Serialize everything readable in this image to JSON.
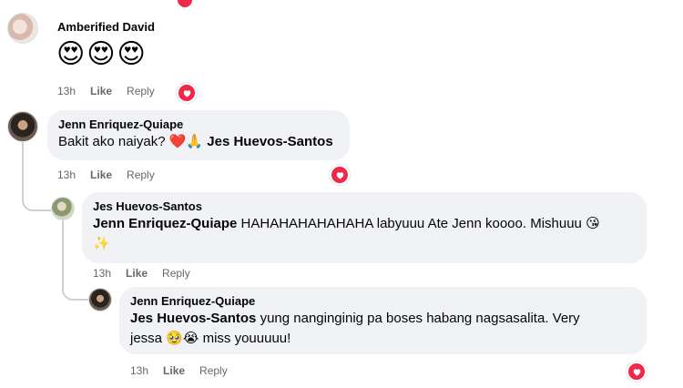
{
  "comments": [
    {
      "author": "Amberified David",
      "emojis": "😍😍😍",
      "time": "13h",
      "like": "Like",
      "reply": "Reply"
    },
    {
      "author": "Jenn Enriquez-Quiape",
      "text": "Bakit ako naiyak?",
      "emoji": "❤️🙏",
      "tag": "Jes Huevos-Santos",
      "time": "13h",
      "like": "Like",
      "reply": "Reply"
    },
    {
      "author": "Jes Huevos-Santos",
      "tag": "Jenn Enriquez-Quiape",
      "text": "HAHAHAHAHAHAHA labyuuu Ate Jenn koooo. Mishuuu",
      "emoji1": "😘",
      "emoji2": "✨",
      "time": "13h",
      "like": "Like",
      "reply": "Reply"
    },
    {
      "author": "Jenn Enriquez-Quiape",
      "tag": "Jes Huevos-Santos",
      "text1": "yung nanginginig pa boses habang nagsasalita. Very",
      "text2": "jessa",
      "emoji": "🥹😭",
      "text3": "miss youuuuu!",
      "time": "13h",
      "like": "Like",
      "reply": "Reply"
    }
  ],
  "colors": {
    "bubble": "#f0f2f5",
    "reaction": "#f02849",
    "meta": "#65676b"
  },
  "icons": {
    "reaction": "heart-icon"
  }
}
